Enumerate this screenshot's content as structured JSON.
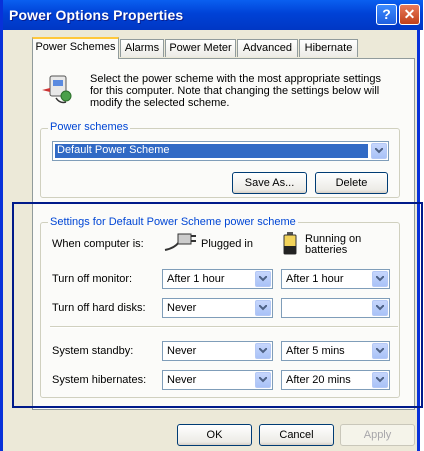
{
  "window": {
    "title": "Power Options Properties",
    "help_glyph": "?",
    "close_glyph": "✕"
  },
  "tabs": [
    {
      "label": "Power Schemes",
      "active": true
    },
    {
      "label": "Alarms"
    },
    {
      "label": "Power Meter"
    },
    {
      "label": "Advanced"
    },
    {
      "label": "Hibernate"
    }
  ],
  "intro": "Select the power scheme with the most appropriate settings for this computer. Note that changing the settings below will modify the selected scheme.",
  "power_schemes": {
    "legend": "Power schemes",
    "selected": "Default Power Scheme",
    "save_as": "Save As...",
    "delete": "Delete"
  },
  "settings": {
    "legend": "Settings for Default Power Scheme power scheme",
    "when_label": "When computer is:",
    "plugged_in": "Plugged in",
    "running_on_batteries": "Running on batteries",
    "rows": [
      {
        "label": "Turn off monitor:",
        "plugged": "After 1 hour",
        "battery": "After 1 hour"
      },
      {
        "label": "Turn off hard disks:",
        "plugged": "Never",
        "battery": ""
      },
      {
        "label": "System standby:",
        "plugged": "Never",
        "battery": "After 5 mins"
      },
      {
        "label": "System hibernates:",
        "plugged": "Never",
        "battery": "After 20 mins"
      }
    ]
  },
  "buttons": {
    "ok": "OK",
    "cancel": "Cancel",
    "apply": "Apply"
  },
  "colors": {
    "titlebar": "#0042d6",
    "legend_text": "#0046d5",
    "highlight_box": "#001a8a",
    "dialog_bg": "#ece9d8"
  }
}
